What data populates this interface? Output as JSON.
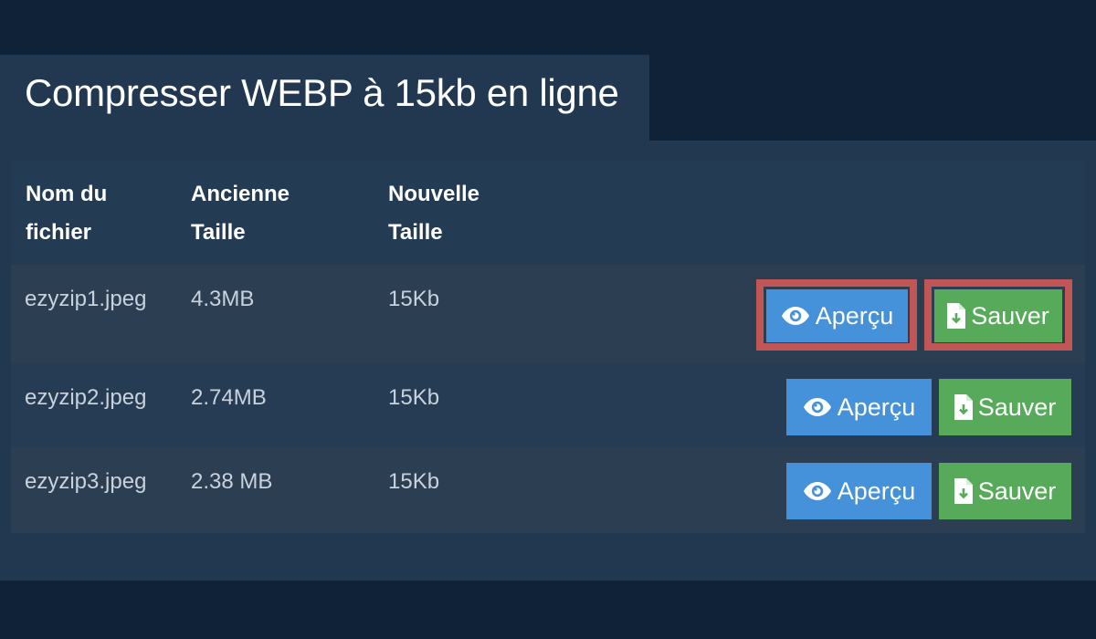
{
  "header": {
    "title": "Compresser WEBP à 15kb en ligne"
  },
  "table": {
    "columns": [
      "Nom du fichier",
      "Ancienne Taille",
      "Nouvelle Taille"
    ],
    "rows": [
      {
        "filename": "ezyzip1.jpeg",
        "old_size": "4.3MB",
        "new_size": "15Kb",
        "preview_label": "Aperçu",
        "save_label": "Sauver",
        "highlighted": true
      },
      {
        "filename": "ezyzip2.jpeg",
        "old_size": "2.74MB",
        "new_size": "15Kb",
        "preview_label": "Aperçu",
        "save_label": "Sauver",
        "highlighted": false
      },
      {
        "filename": "ezyzip3.jpeg",
        "old_size": "2.38 MB",
        "new_size": "15Kb",
        "preview_label": "Aperçu",
        "save_label": "Sauver",
        "highlighted": false
      }
    ]
  },
  "icons": {
    "preview": "eye-icon",
    "save": "file-download-icon"
  },
  "colors": {
    "background": "#0f2238",
    "panel": "#213850",
    "preview_button": "#4592da",
    "save_button": "#57aa5a",
    "highlight_border": "#c05656"
  }
}
